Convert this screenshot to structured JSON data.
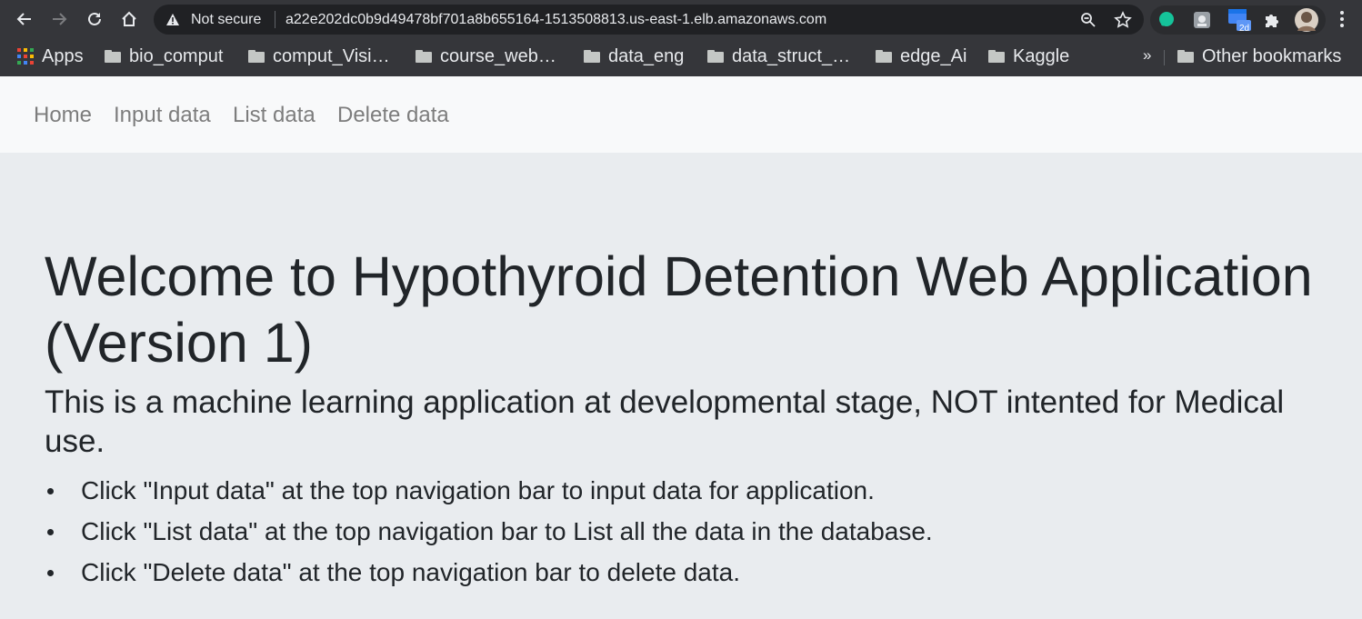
{
  "browser": {
    "security_label": "Not secure",
    "url": "a22e202dc0b9d49478bf701a8b655164-1513508813.us-east-1.elb.amazonaws.com",
    "extension_badge": "2d",
    "bookmarks": [
      {
        "label": "Apps",
        "icon": "apps-grid-icon"
      },
      {
        "label": "bio_comput",
        "icon": "folder-icon"
      },
      {
        "label": "comput_Visi…",
        "icon": "folder-icon"
      },
      {
        "label": "course_web…",
        "icon": "folder-icon"
      },
      {
        "label": "data_eng",
        "icon": "folder-icon"
      },
      {
        "label": "data_struct_…",
        "icon": "folder-icon"
      },
      {
        "label": "edge_Ai",
        "icon": "folder-icon"
      },
      {
        "label": "Kaggle",
        "icon": "folder-icon"
      }
    ],
    "overflow_label": "»",
    "other_bookmarks": "Other bookmarks"
  },
  "nav": {
    "links": [
      "Home",
      "Input data",
      "List data",
      "Delete data"
    ]
  },
  "main": {
    "title": "Welcome to Hypothyroid Detention Web Application (Version 1)",
    "lead": "This is a machine learning application at developmental stage, NOT intented for Medical use.",
    "instructions": [
      "Click \"Input data\" at the top navigation bar to input data for application.",
      "Click \"List data\" at the top navigation bar to List all the data in the database.",
      "Click \"Delete data\" at the top navigation bar to delete data."
    ]
  },
  "colors": {
    "chrome_bg": "#35363a",
    "omnibox_bg": "#202124",
    "navbar_bg": "#f8f9fa",
    "jumbotron_bg": "#e9ecef",
    "nav_link": "#7d7d7d",
    "text": "#212529"
  }
}
